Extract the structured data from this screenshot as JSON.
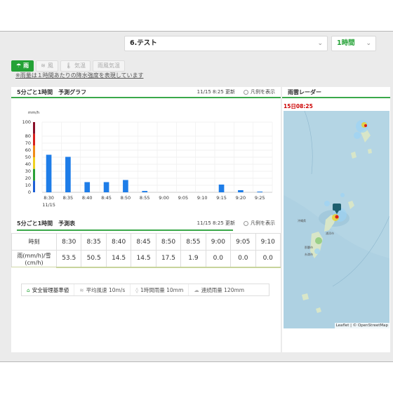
{
  "header": {
    "location_select": "6.テスト",
    "interval_select": "1時間"
  },
  "tabs": [
    {
      "label": "雨",
      "icon": "cloud-rain-icon",
      "active": true
    },
    {
      "label": "風",
      "icon": "wind-icon",
      "active": false
    },
    {
      "label": "気温",
      "icon": "thermometer-icon",
      "active": false
    },
    {
      "label": "雨風気温",
      "icon": "combined-icon",
      "active": false
    }
  ],
  "note": "※雨量は１時間あたりの降水強度を表現しています",
  "graph_panel": {
    "title": "5分ごと1時間　予測グラフ",
    "updated": "11/15 8:25 更新",
    "legend_label": "凡例を表示"
  },
  "table_panel": {
    "title": "5分ごと1時間　予測表",
    "updated": "11/15 8:25 更新",
    "legend_label": "凡例を表示",
    "row_time_label": "時刻",
    "row_value_label": "雨(mm/h)/雪(cm/h)",
    "times": [
      "8:30",
      "8:35",
      "8:40",
      "8:45",
      "8:50",
      "8:55",
      "9:00",
      "9:05",
      "9:10"
    ],
    "values": [
      "53.5",
      "50.5",
      "14.5",
      "14.5",
      "17.5",
      "1.9",
      "0.0",
      "0.0",
      "0.0"
    ]
  },
  "safety_bar": {
    "title": "安全管理基準値",
    "wind": "平均風速 10m/s",
    "rain_hour": "1時間雨量 10mm",
    "rain_cont": "連続雨量 120mm"
  },
  "radar_panel": {
    "title": "雨雲レーダー",
    "time": "15日08:25",
    "attribution": "Leaflet | © OpenStreetMap",
    "place_labels": [
      "沖縄県",
      "浦添市",
      "那覇市",
      "糸満市"
    ]
  },
  "colors": {
    "accent_green": "#24a236",
    "bar_blue": "#1e7de8",
    "radar_time_red": "#cc0000"
  },
  "chart_data": {
    "type": "bar",
    "unit_label": "mm/h",
    "categories": [
      "8:30",
      "8:35",
      "8:40",
      "8:45",
      "8:50",
      "8:55",
      "9:00",
      "9:05",
      "9:10",
      "9:15",
      "9:20",
      "9:25"
    ],
    "sublabel_first": "11/15",
    "values": [
      53.5,
      50.5,
      14.5,
      14.5,
      17.5,
      1.9,
      0.0,
      0.0,
      0.0,
      11.0,
      3.0,
      1.0
    ],
    "yticks": [
      0,
      10,
      20,
      30,
      40,
      50,
      60,
      70,
      80,
      100
    ],
    "ylim": [
      0,
      100
    ],
    "grid": true,
    "scale_colors": [
      "#1e5fd6",
      "#2aa037",
      "#f0d020",
      "#f08a18",
      "#d8201c",
      "#8a1028"
    ]
  }
}
